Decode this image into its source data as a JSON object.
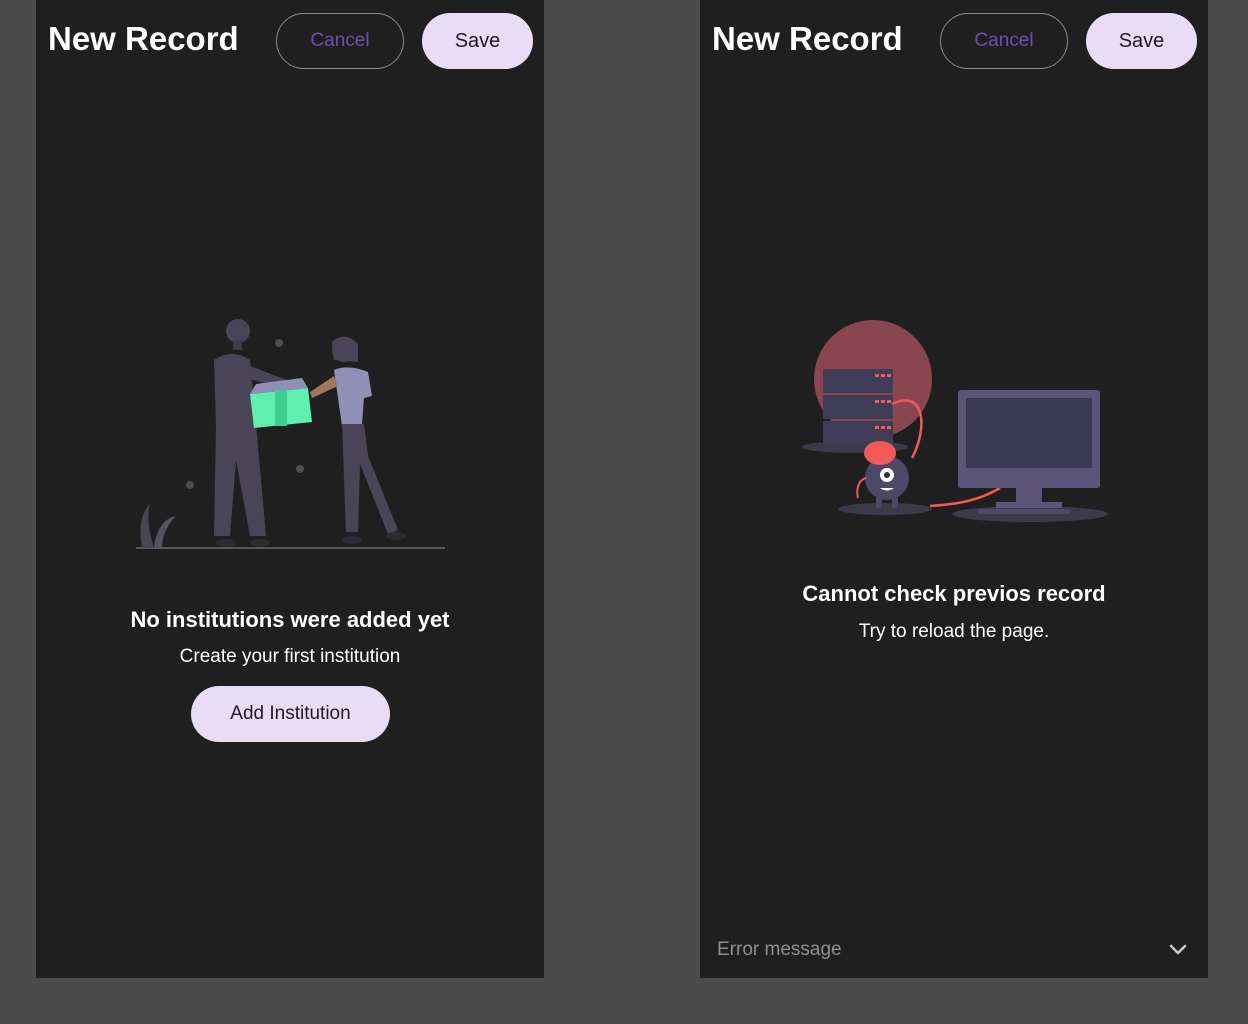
{
  "left_panel": {
    "title": "New Record",
    "cancel_label": "Cancel",
    "save_label": "Save",
    "empty_state": {
      "heading": "No institutions were added yet",
      "subtext": "Create your first institution",
      "button_label": "Add Institution"
    }
  },
  "right_panel": {
    "title": "New Record",
    "cancel_label": "Cancel",
    "save_label": "Save",
    "error_state": {
      "heading": "Cannot check previos record",
      "subtext": "Try to reload the page."
    },
    "error_toggle": {
      "label": "Error message",
      "icon": "chevron-down-icon"
    }
  },
  "colors": {
    "background": "#4b4b4b",
    "panel": "#1f1f1f",
    "button_fill": "#e8dcf7",
    "cancel_text": "#6c4fb2",
    "illustration_purple": "#5d5578",
    "illustration_accent_green": "#5ff0b0",
    "illustration_accent_red": "#f25a5a"
  }
}
